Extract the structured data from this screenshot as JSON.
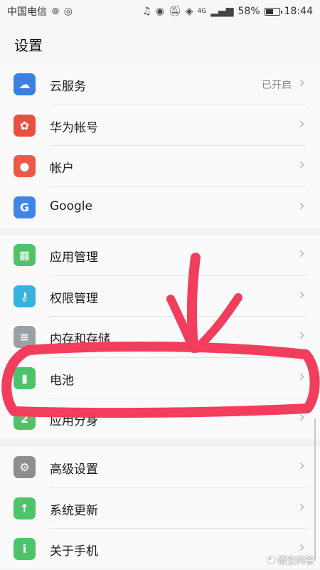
{
  "status_bar": {
    "carrier": "中国电信",
    "battery_percent": "58%",
    "battery_level": 0.58,
    "time": "18:44",
    "network": "4G"
  },
  "header": {
    "title": "设置"
  },
  "groups": [
    {
      "items": [
        {
          "label": "云服务",
          "value": "已开启",
          "icon": "cloud-icon",
          "color": "#3b7fe0"
        },
        {
          "label": "华为帐号",
          "icon": "huawei-icon",
          "color": "#e8513f"
        },
        {
          "label": "帐户",
          "icon": "person-icon",
          "color": "#ea5a48"
        },
        {
          "label": "Google",
          "icon": "google-icon",
          "color": "#3f86e6"
        }
      ]
    },
    {
      "items": [
        {
          "label": "应用管理",
          "icon": "grid-icon",
          "color": "#4dc36a"
        },
        {
          "label": "权限管理",
          "icon": "key-icon",
          "color": "#35b3de"
        },
        {
          "label": "内存和存储",
          "icon": "storage-icon",
          "color": "#9aa0a6"
        },
        {
          "label": "电池",
          "icon": "battery-icon",
          "color": "#4dc36a"
        },
        {
          "label": "应用分身",
          "icon": "clone-icon",
          "color": "#4dc36a"
        }
      ]
    },
    {
      "items": [
        {
          "label": "高级设置",
          "icon": "gear-icon",
          "color": "#8e8e8e"
        },
        {
          "label": "系统更新",
          "icon": "update-icon",
          "color": "#4dc36a"
        },
        {
          "label": "关于手机",
          "icon": "info-icon",
          "color": "#4dc36a"
        }
      ]
    }
  ],
  "watermark": "悟空问答",
  "annotation_color": "#f23d5c"
}
